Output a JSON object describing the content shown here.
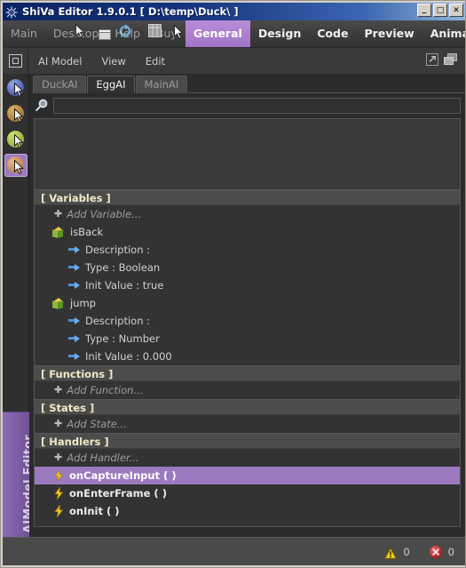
{
  "window": {
    "title": "ShiVa Editor 1.9.0.1 [ D:\\temp\\Duck\\ ]",
    "icon": "shiva-sun-icon",
    "controls": {
      "minimize": "_",
      "maximize": "□",
      "close": "✕"
    }
  },
  "menubar": {
    "items": [
      {
        "label": "Main",
        "active": false
      },
      {
        "label": "Desktop",
        "active": false
      },
      {
        "label": "Help",
        "active": false
      },
      {
        "label": "Buy",
        "active": false
      },
      {
        "label": "General",
        "active": true
      },
      {
        "label": "Design",
        "active": false
      },
      {
        "label": "Code",
        "active": false
      },
      {
        "label": "Preview",
        "active": false
      },
      {
        "label": "Animation",
        "active": false
      }
    ]
  },
  "toolbar": {
    "module_icon": "module-square-icon",
    "menus": [
      {
        "label": "AI Model"
      },
      {
        "label": "View"
      },
      {
        "label": "Edit"
      }
    ],
    "right_icons": [
      {
        "name": "popout-window-icon"
      },
      {
        "name": "cascade-windows-icon"
      }
    ]
  },
  "rail": {
    "icons": [
      {
        "name": "rail-icon-blue",
        "color": "#5a6fc0",
        "selected": false
      },
      {
        "name": "rail-icon-gold",
        "color": "#b08a3e",
        "selected": false
      },
      {
        "name": "rail-icon-green",
        "color": "#9bb845",
        "selected": false
      },
      {
        "name": "rail-icon-orange",
        "color": "#c18a52",
        "selected": true
      }
    ],
    "label": "AIModel Editor"
  },
  "panel": {
    "tabs": [
      {
        "label": "DuckAI",
        "active": false
      },
      {
        "label": "EggAI",
        "active": true
      },
      {
        "label": "MainAI",
        "active": false
      }
    ],
    "search": {
      "icon": "magnifier-icon",
      "value": "",
      "placeholder": ""
    },
    "sections": [
      {
        "title": "[ Variables ]",
        "rows": [
          {
            "kind": "add",
            "label": "Add Variable...",
            "plus": "✚"
          },
          {
            "kind": "var",
            "label": "isBack",
            "icon": "variable-cube-icon"
          },
          {
            "kind": "sub",
            "label": "Description :",
            "icon": "arrow-icon"
          },
          {
            "kind": "sub",
            "label": "Type : Boolean",
            "icon": "arrow-icon"
          },
          {
            "kind": "sub",
            "label": "Init Value : true",
            "icon": "arrow-icon"
          },
          {
            "kind": "var",
            "label": "jump",
            "icon": "variable-cube-icon"
          },
          {
            "kind": "sub",
            "label": "Description :",
            "icon": "arrow-icon"
          },
          {
            "kind": "sub",
            "label": "Type : Number",
            "icon": "arrow-icon"
          },
          {
            "kind": "sub",
            "label": "Init Value : 0.000",
            "icon": "arrow-icon"
          }
        ]
      },
      {
        "title": "[ Functions ]",
        "rows": [
          {
            "kind": "add",
            "label": "Add Function...",
            "plus": "✚"
          }
        ]
      },
      {
        "title": "[ States ]",
        "rows": [
          {
            "kind": "add",
            "label": "Add State...",
            "plus": "✚"
          }
        ]
      },
      {
        "title": "[ Handlers ]",
        "rows": [
          {
            "kind": "add",
            "label": "Add Handler...",
            "plus": "✚"
          },
          {
            "kind": "handler",
            "label": "onCaptureInput ( )",
            "icon": "lightning-bolt-icon",
            "selected": true
          },
          {
            "kind": "handler",
            "label": "onEnterFrame ( )",
            "icon": "lightning-bolt-icon",
            "selected": false
          },
          {
            "kind": "handler",
            "label": "onInit ( )",
            "icon": "lightning-bolt-icon",
            "selected": false
          }
        ]
      }
    ]
  },
  "statusbar": {
    "warnings": {
      "icon": "warning-triangle-icon",
      "count": "0"
    },
    "errors": {
      "icon": "error-circle-icon",
      "count": "0"
    }
  },
  "colors": {
    "accent_purple": "#9b7ac0",
    "title_blue": "#15337e",
    "panel_bg": "#333333",
    "section_header": "#4c4c4c"
  }
}
